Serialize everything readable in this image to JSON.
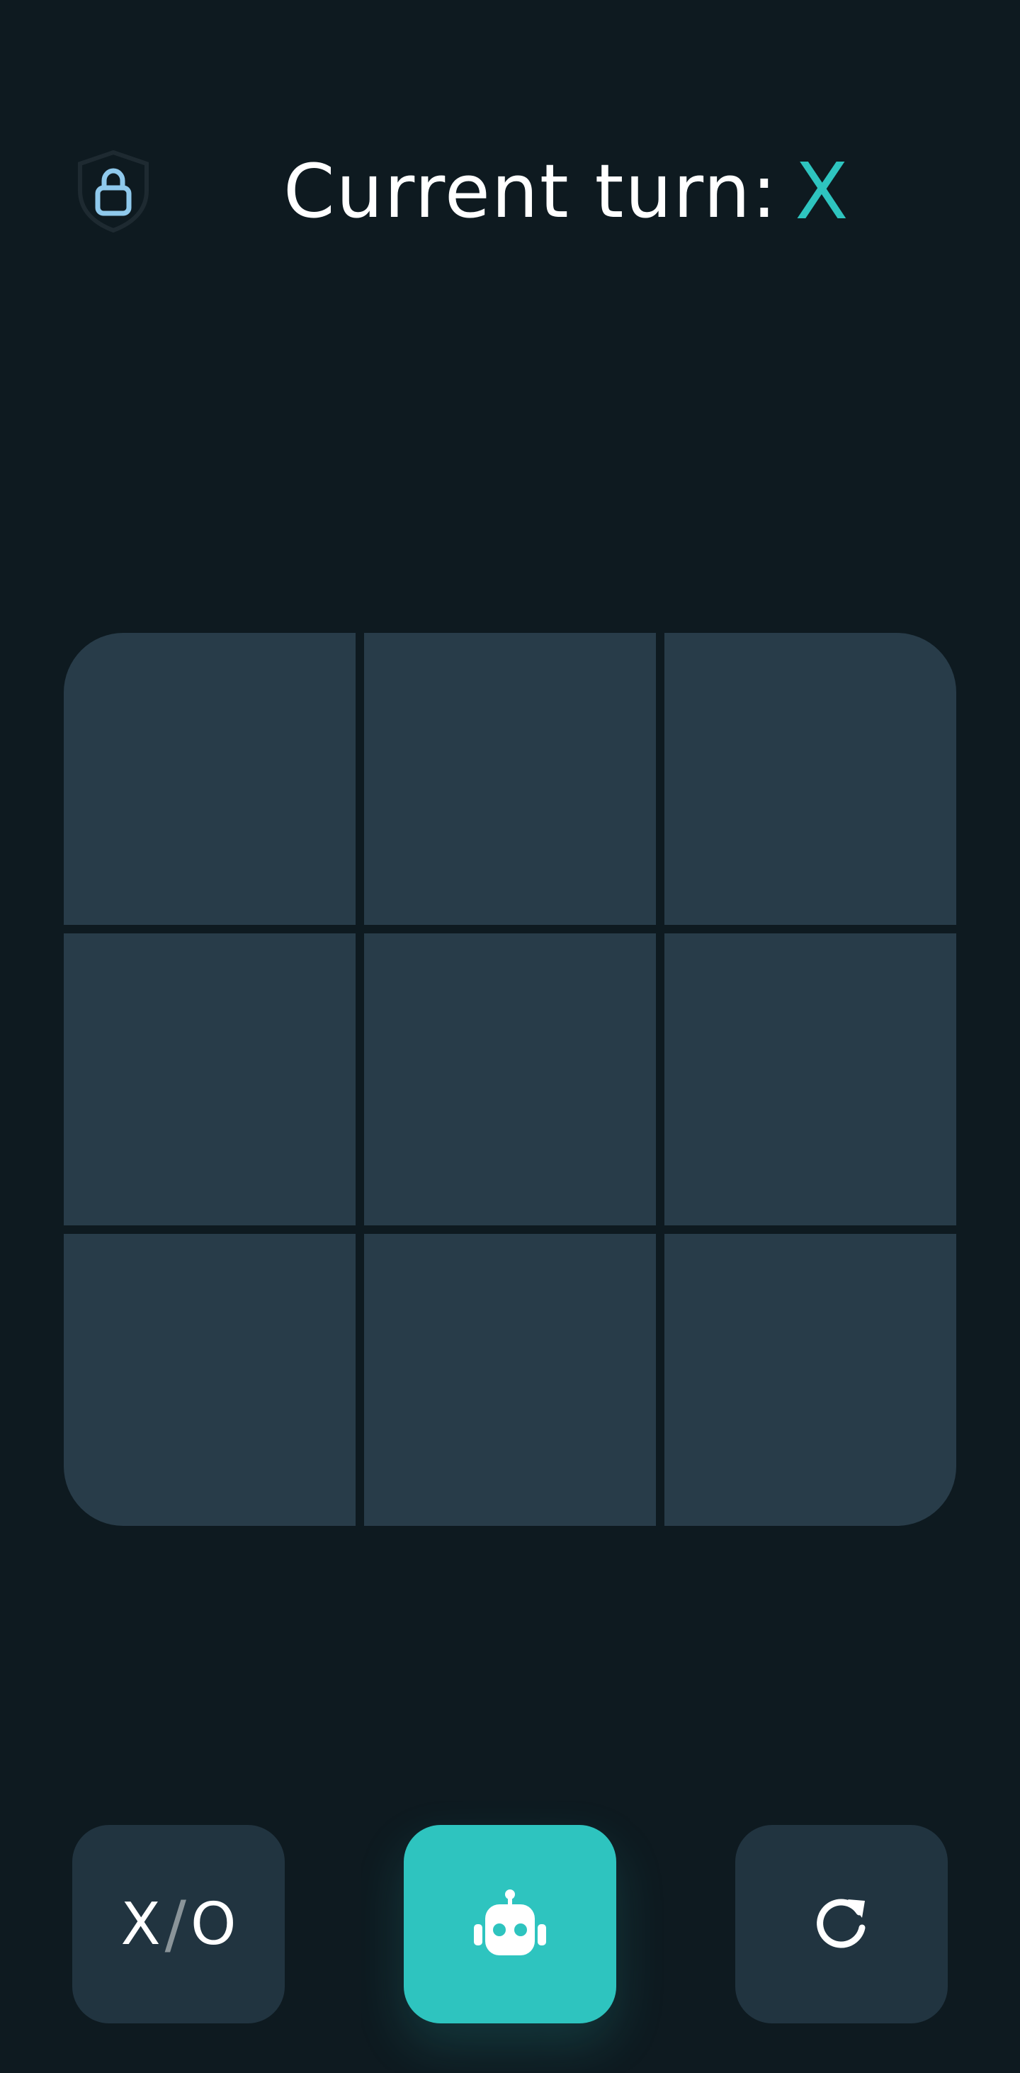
{
  "header": {
    "turn_label": "Current turn:",
    "current_player": "X"
  },
  "board": {
    "cells": [
      "",
      "",
      "",
      "",
      "",
      "",
      "",
      "",
      ""
    ]
  },
  "controls": {
    "mode": {
      "left": "X",
      "separator": "/",
      "right": "O"
    },
    "ai_icon": "robot-icon",
    "reset_icon": "refresh-icon"
  },
  "colors": {
    "background": "#0e1a20",
    "cell": "#283c49",
    "button": "#213440",
    "accent": "#2ec4bf",
    "shield_icon": "#8fc9ec"
  }
}
